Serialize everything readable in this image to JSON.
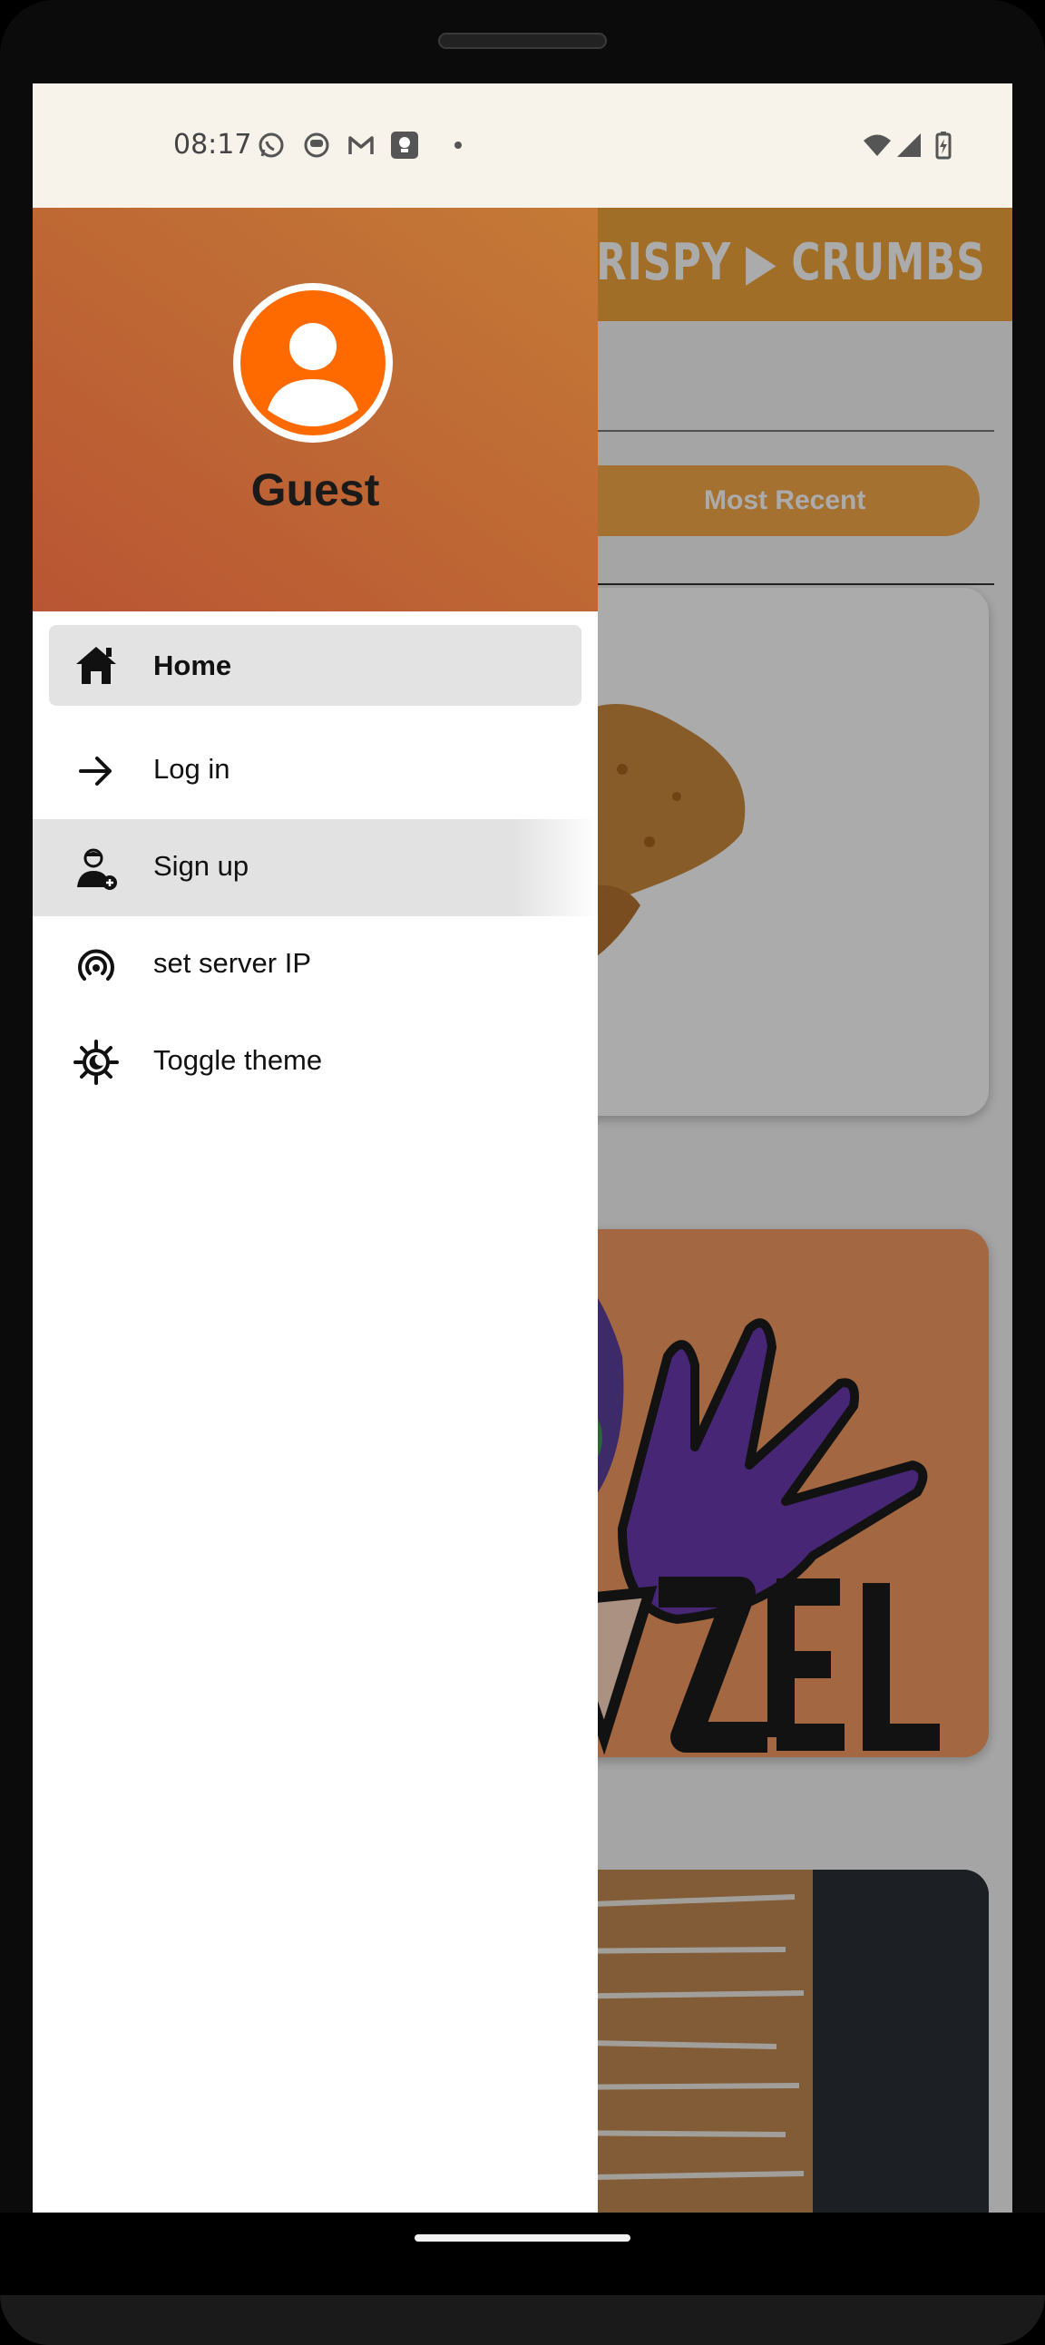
{
  "status_bar": {
    "time": "08:17",
    "left_icons": [
      "whatsapp-icon",
      "app-icon",
      "gmail-icon",
      "photo-icon",
      "dot-icon"
    ],
    "right_icons": [
      "wifi-icon",
      "signal-icon",
      "battery-icon"
    ]
  },
  "app_bar": {
    "brand": "CRISPY ▶ CRUMBS"
  },
  "content": {
    "filter_chip": "Most Recent"
  },
  "drawer": {
    "user_name": "Guest",
    "items": [
      {
        "label": "Home",
        "icon": "home-icon",
        "selected": true
      },
      {
        "label": "Log in",
        "icon": "arrow-right-icon"
      },
      {
        "label": "Sign up",
        "icon": "add-user-icon"
      },
      {
        "label": "set server IP",
        "icon": "broadcast-icon"
      },
      {
        "label": "Toggle theme",
        "icon": "theme-toggle-icon"
      }
    ]
  },
  "colors": {
    "accent": "#f0a43b",
    "header_gradient_start": "#b95533",
    "header_gradient_end": "#c47a36",
    "avatar": "#ff6a00",
    "status_bar_bg": "#f7f2ea"
  }
}
